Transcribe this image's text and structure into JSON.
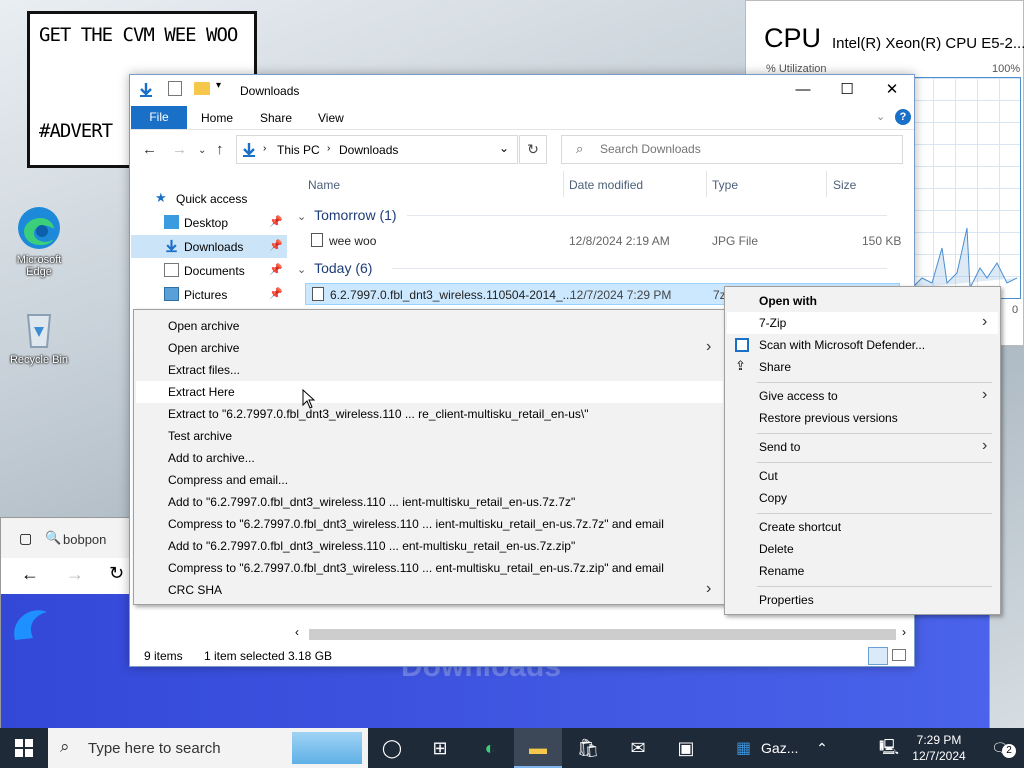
{
  "advert": {
    "line1": "GET THE CVM WEE WOO",
    "line2": "#ADVERT"
  },
  "desktop_icons": {
    "edge": "Microsoft Edge",
    "recycle": "Recycle Bin"
  },
  "cpu": {
    "title": "CPU",
    "model": "Intel(R) Xeon(R) CPU E5-2...",
    "utilization_label": "% Utilization",
    "max": "100%",
    "min": "0"
  },
  "browser": {
    "search_fragment": "bobpon",
    "page_title": "Downloads"
  },
  "explorer": {
    "title": "Downloads",
    "ribbon_tabs": [
      "File",
      "Home",
      "Share",
      "View"
    ],
    "breadcrumb": [
      "This PC",
      "Downloads"
    ],
    "search_placeholder": "Search Downloads",
    "nav": [
      {
        "label": "Quick access"
      },
      {
        "label": "Desktop"
      },
      {
        "label": "Downloads"
      },
      {
        "label": "Documents"
      },
      {
        "label": "Pictures"
      }
    ],
    "columns": [
      "Name",
      "Date modified",
      "Type",
      "Size"
    ],
    "groups": [
      {
        "label": "Tomorrow (1)"
      },
      {
        "label": "Today (6)"
      }
    ],
    "files": [
      {
        "name": "wee woo",
        "date": "12/8/2024 2:19 AM",
        "type": "JPG File",
        "size": "150 KB"
      },
      {
        "name": "6.2.7997.0.fbl_dnt3_wireless.110504-2014_...",
        "date": "12/7/2024 7:29 PM",
        "type": "7z",
        "size": ""
      }
    ],
    "status": {
      "items": "9 items",
      "selected": "1 item selected",
      "size": "3.18 GB"
    }
  },
  "zip_menu": [
    "Open archive",
    "Open archive",
    "Extract files...",
    "Extract Here",
    "Extract to \"6.2.7997.0.fbl_dnt3_wireless.110 ... re_client-multisku_retail_en-us\\\"",
    "Test archive",
    "Add to archive...",
    "Compress and email...",
    "Add to \"6.2.7997.0.fbl_dnt3_wireless.110 ... ient-multisku_retail_en-us.7z.7z\"",
    "Compress to \"6.2.7997.0.fbl_dnt3_wireless.110 ... ient-multisku_retail_en-us.7z.7z\" and email",
    "Add to \"6.2.7997.0.fbl_dnt3_wireless.110 ... ent-multisku_retail_en-us.7z.zip\"",
    "Compress to \"6.2.7997.0.fbl_dnt3_wireless.110 ... ent-multisku_retail_en-us.7z.zip\" and email",
    "CRC SHA"
  ],
  "context_menu": {
    "open_with": "Open with",
    "seven_zip": "7-Zip",
    "scan": "Scan with Microsoft Defender...",
    "share": "Share",
    "give_access": "Give access to",
    "restore": "Restore previous versions",
    "send_to": "Send to",
    "cut": "Cut",
    "copy": "Copy",
    "create_shortcut": "Create shortcut",
    "delete": "Delete",
    "rename": "Rename",
    "properties": "Properties"
  },
  "taskbar": {
    "search_placeholder": "Type here to search",
    "app_label": "Gaz...",
    "time": "7:29 PM",
    "date": "12/7/2024",
    "notifications": "2"
  },
  "colors": {
    "accent": "#1a6fc6",
    "taskbar": "#1f2a38",
    "selection": "#cce8ff"
  }
}
